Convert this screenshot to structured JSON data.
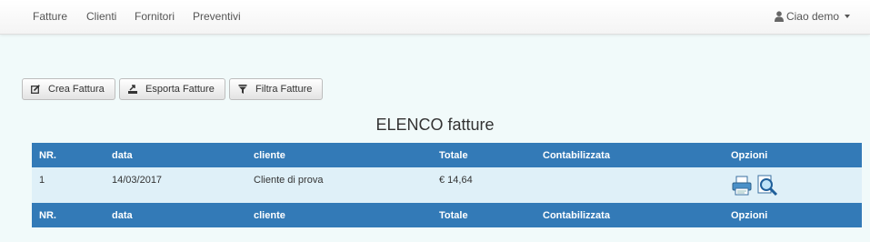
{
  "nav": {
    "items": [
      "Fatture",
      "Clienti",
      "Fornitori",
      "Preventivi"
    ],
    "user_label": "Ciao demo",
    "user_icon": "user-icon"
  },
  "toolbar": {
    "crea_label": "Crea Fattura",
    "esporta_label": "Esporta Fatture",
    "filtra_label": "Filtra Fatture"
  },
  "page_title": "ELENCO fatture",
  "table": {
    "headers": [
      "NR.",
      "data",
      "cliente",
      "Totale",
      "Contabilizzata",
      "Opzioni"
    ],
    "rows": [
      {
        "nr": "1",
        "data": "14/03/2017",
        "cliente": "Cliente di prova",
        "totale": "€ 14,64",
        "contabilizzata": "",
        "options": [
          "print-icon",
          "view-icon"
        ]
      }
    ],
    "footer": [
      "NR.",
      "data",
      "cliente",
      "Totale",
      "Contabilizzata",
      "Opzioni"
    ]
  },
  "colors": {
    "header_bg": "#337ab7",
    "row_bg": "#dff0f8",
    "page_bg": "#f1fafa"
  }
}
